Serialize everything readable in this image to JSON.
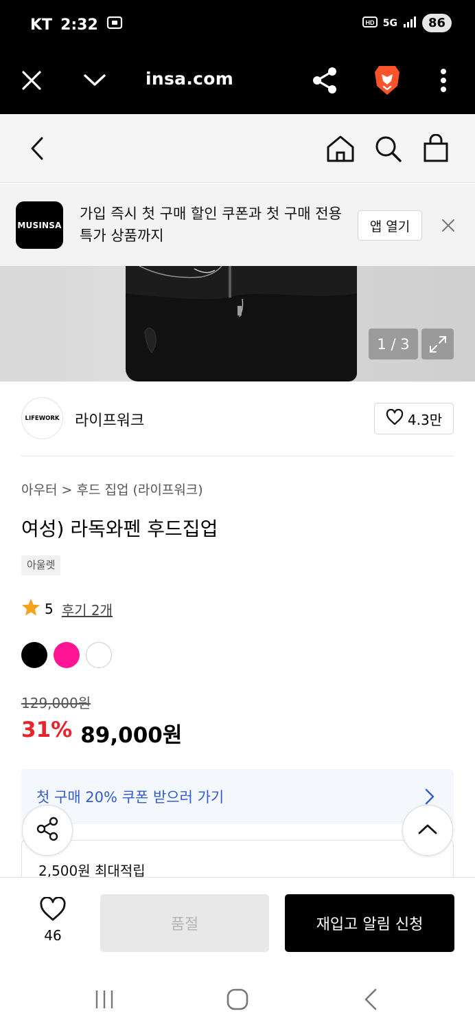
{
  "status_bar": {
    "carrier": "KT",
    "time": "2:32",
    "network": "5G",
    "battery": "86"
  },
  "browser": {
    "url": "insa.com"
  },
  "app_banner": {
    "logo_text": "MUSINSA",
    "message": "가입 즉시 첫 구매 할인 쿠폰과 첫 구매 전용 특가 상품까지",
    "open_app_label": "앱 열기"
  },
  "gallery": {
    "counter": "1 / 3"
  },
  "brand": {
    "logo_text": "LIFEWORK",
    "name": "라이프워크",
    "like_count": "4.3만"
  },
  "product": {
    "breadcrumb_category": "아우터",
    "breadcrumb_separator": ">",
    "breadcrumb_subcategory": "후드 집업 (라이프워크)",
    "title": "여성) 라독와펜 후드집업",
    "tag": "아울렛",
    "rating": "5",
    "reviews": "후기 2개",
    "colors": [
      "#000000",
      "#ff1493",
      "#ffffff"
    ],
    "original_price": "129,000원",
    "discount": "31%",
    "price": "89,000원"
  },
  "coupon": {
    "text": "첫 구매 20% 쿠폰 받으러 가기"
  },
  "points": {
    "text": "2,500원 최대적립"
  },
  "bottom_bar": {
    "like_count": "46",
    "soldout_label": "품절",
    "restock_label": "재입고 알림 신청"
  }
}
